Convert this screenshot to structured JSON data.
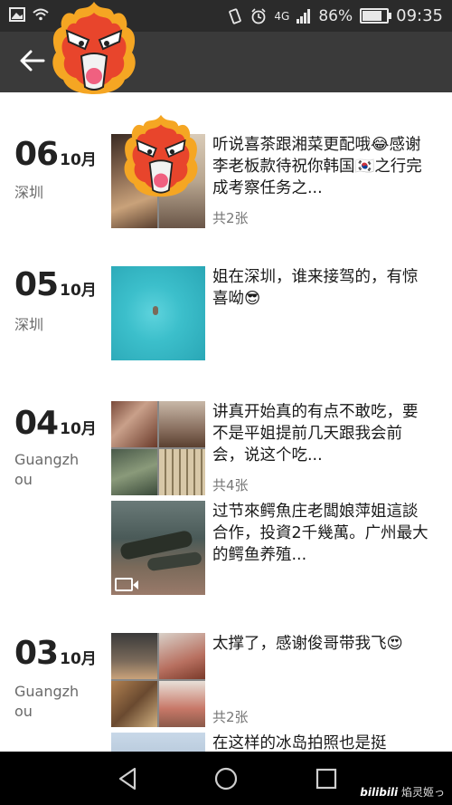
{
  "status_bar": {
    "network": "4G",
    "battery_percent_label": "86%",
    "battery_level": 0.86,
    "time": "09:35",
    "icons": [
      "image-icon",
      "wifi-icon",
      "vibrate-icon",
      "alarm-icon",
      "signal-icon",
      "battery-icon"
    ]
  },
  "title_bar": {
    "back_icon": "back-arrow-icon"
  },
  "feed": {
    "entries": [
      {
        "day": "06",
        "month": "10月",
        "location": "深圳",
        "posts": [
          {
            "text": "听说喜茶跟湘菜更配哦😂感谢李老板款待祝你韩国🇰🇷之行完成考察任务之...",
            "count": "共2张"
          }
        ]
      },
      {
        "day": "05",
        "month": "10月",
        "location": "深圳",
        "posts": [
          {
            "text": "姐在深圳，谁来接驾的，有惊喜呦😎",
            "count": ""
          }
        ]
      },
      {
        "day": "04",
        "month": "10月",
        "location": "Guangzh\nou",
        "posts": [
          {
            "text": "讲真开始真的有点不敢吃，要不是平姐提前几天跟我会前会，说这个吃...",
            "count": "共4张"
          },
          {
            "text": "过节來鳄魚庄老闆娘萍姐這談合作，投資2千幾萬。广州最大的鳄鱼养殖...",
            "count": ""
          }
        ]
      },
      {
        "day": "03",
        "month": "10月",
        "location": "Guangzh\nou",
        "posts": [
          {
            "text": "太撑了，感谢俊哥带我飞😍",
            "count": "共2张"
          },
          {
            "text": "在这样的冰岛拍照也是挺",
            "count": ""
          }
        ]
      }
    ]
  },
  "nav_bar": {
    "icons": [
      "nav-back-icon",
      "nav-home-icon",
      "nav-recent-icon"
    ]
  },
  "watermark": {
    "brand": "bilibili",
    "user": "焰灵姬っ"
  }
}
